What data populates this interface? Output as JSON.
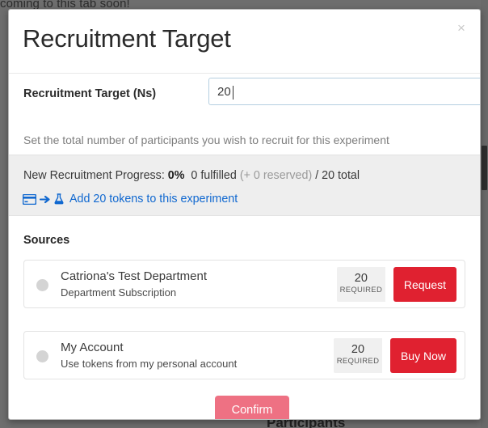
{
  "background": {
    "text_top": "coming to this tab soon!",
    "text_bottom": "Participants"
  },
  "modal": {
    "title": "Recruitment Target",
    "close_label": "×",
    "target": {
      "label": "Recruitment Target (Ns)",
      "value": "20",
      "placeholder": "",
      "help": "Set the total number of participants you wish to recruit for this experiment"
    },
    "progress": {
      "prefix": "New Recruitment Progress:",
      "percent": "0%",
      "fulfilled": "0 fulfilled",
      "reserved": "(+ 0 reserved)",
      "total": "/ 20 total",
      "link_text": "Add 20 tokens to this experiment",
      "link_color": "#1068d0",
      "icons": [
        "credit-card-icon",
        "arrow-right-icon",
        "flask-icon"
      ]
    },
    "sources": {
      "heading": "Sources",
      "items": [
        {
          "name": "Catriona's Test Department",
          "subtitle": "Department Subscription",
          "required_count": "20",
          "required_label": "REQUIRED",
          "action_label": "Request",
          "action_color": "#e02130",
          "selected": false
        },
        {
          "name": "My Account",
          "subtitle": "Use tokens from my personal account",
          "required_count": "20",
          "required_label": "REQUIRED",
          "action_label": "Buy Now",
          "action_color": "#e02130",
          "selected": false
        }
      ]
    },
    "confirm": {
      "label": "Confirm",
      "color": "#ee7183",
      "disabled": true
    }
  }
}
